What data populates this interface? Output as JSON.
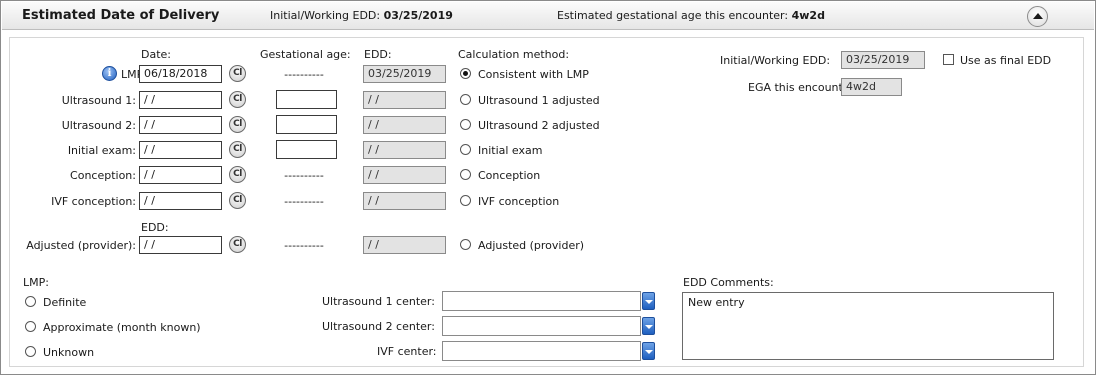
{
  "header": {
    "title": "Estimated Date of Delivery",
    "initial_edd_label": "Initial/Working EDD:",
    "initial_edd_value": "03/25/2019",
    "ega_label": "Estimated gestational age this encounter:",
    "ega_value": "4w2d"
  },
  "columns": {
    "date": "Date:",
    "gest_age": "Gestational age:",
    "edd": "EDD:",
    "calc_method": "Calculation method:",
    "edd_below": "EDD:"
  },
  "clear_label": "Cl",
  "rows": [
    {
      "label": "LMP:",
      "date": "06/18/2018",
      "gest": "----------",
      "edd": "03/25/2019",
      "method": "Consistent with LMP"
    },
    {
      "label": "Ultrasound 1:",
      "date": " / /",
      "gest": "",
      "edd": " / /",
      "method": "Ultrasound 1 adjusted"
    },
    {
      "label": "Ultrasound 2:",
      "date": " / /",
      "gest": "",
      "edd": " / /",
      "method": "Ultrasound 2 adjusted"
    },
    {
      "label": "Initial exam:",
      "date": " / /",
      "gest": "",
      "edd": " / /",
      "method": "Initial exam"
    },
    {
      "label": "Conception:",
      "date": " / /",
      "gest": "----------",
      "edd": " / /",
      "method": "Conception"
    },
    {
      "label": "IVF conception:",
      "date": " / /",
      "gest": "----------",
      "edd": " / /",
      "method": "IVF conception"
    },
    {
      "label": "Adjusted (provider):",
      "date": " / /",
      "gest": "----------",
      "edd": " / /",
      "method": "Adjusted (provider)"
    }
  ],
  "right_panel": {
    "initial_edd_label": "Initial/Working EDD:",
    "initial_edd_value": "03/25/2019",
    "use_final_label": "Use as final EDD",
    "ega_label": "EGA this encounter:",
    "ega_value": "4w2d"
  },
  "lmp_section": {
    "title": "LMP:",
    "options": [
      "Definite",
      "Approximate (month known)",
      "Unknown"
    ]
  },
  "centers": {
    "us1_label": "Ultrasound 1 center:",
    "us2_label": "Ultrasound 2 center:",
    "ivf_label": "IVF center:"
  },
  "comments": {
    "label": "EDD Comments:",
    "value": "New entry"
  }
}
